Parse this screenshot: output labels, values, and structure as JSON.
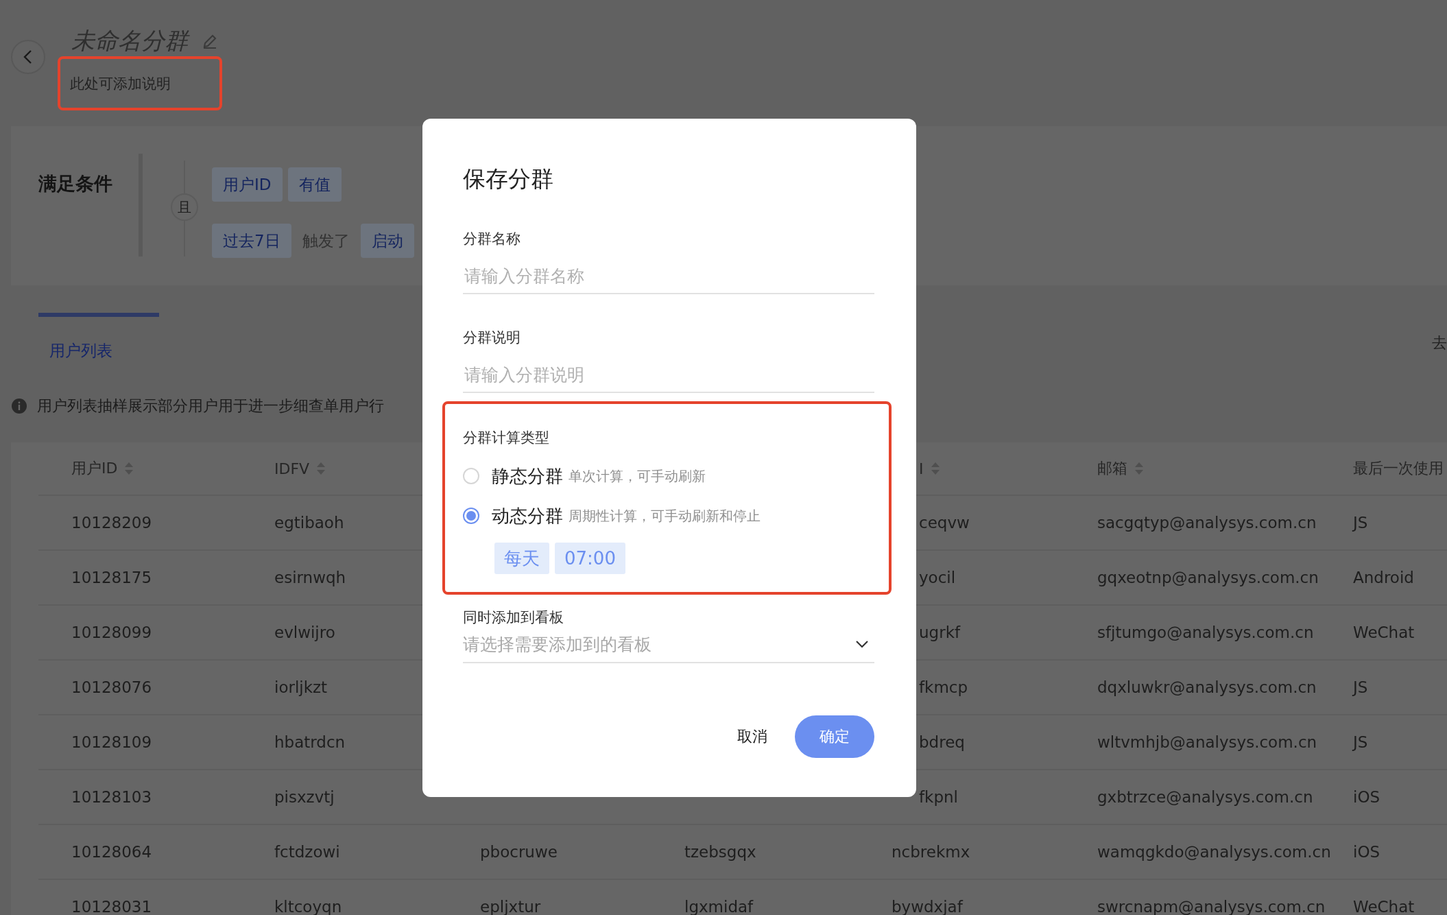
{
  "header": {
    "title": "未命名分群",
    "description": "此处可添加说明",
    "description_highlighted": true
  },
  "conditions": {
    "label": "满足条件",
    "connector": "且",
    "rows": [
      {
        "items": [
          {
            "kind": "tag",
            "text": "用户ID"
          },
          {
            "kind": "tag",
            "text": "有值"
          }
        ]
      },
      {
        "items": [
          {
            "kind": "tag",
            "text": "过去7日"
          },
          {
            "kind": "text",
            "text": "触发了"
          },
          {
            "kind": "tag",
            "text": "启动"
          }
        ]
      }
    ]
  },
  "tabs": [
    {
      "label": "用户列表",
      "selected": true
    }
  ],
  "side_link": "去",
  "notice": "用户列表抽样展示部分用户用于进一步细查单用户行",
  "table": {
    "columns": [
      {
        "label": "用户ID",
        "sortable": true
      },
      {
        "label": "IDFV",
        "sortable": true
      },
      null,
      null,
      {
        "label": "I",
        "sortable": true,
        "clipped": true
      },
      {
        "label": "邮箱",
        "sortable": true
      },
      {
        "label": "最后一次使用"
      }
    ],
    "rows": [
      {
        "cells": [
          {
            "text": "10128209"
          },
          {
            "text": "egtibaoh"
          },
          null,
          null,
          {
            "text": "ceqvw",
            "clipped": true
          },
          {
            "text": "sacgqtyp@analysys.com.cn"
          },
          {
            "text": "JS"
          }
        ]
      },
      {
        "cells": [
          {
            "text": "10128175"
          },
          {
            "text": "esirnwqh"
          },
          null,
          null,
          {
            "text": "yocil",
            "clipped": true
          },
          {
            "text": "gqxeotnp@analysys.com.cn"
          },
          {
            "text": "Android"
          }
        ]
      },
      {
        "cells": [
          {
            "text": "10128099"
          },
          {
            "text": "evlwijro"
          },
          null,
          null,
          {
            "text": "ugrkf",
            "clipped": true
          },
          {
            "text": "sfjtumgo@analysys.com.cn"
          },
          {
            "text": "WeChat"
          }
        ]
      },
      {
        "cells": [
          {
            "text": "10128076"
          },
          {
            "text": "iorljkzt"
          },
          null,
          null,
          {
            "text": "fkmcp",
            "clipped": true
          },
          {
            "text": "dqxluwkr@analysys.com.cn"
          },
          {
            "text": "JS"
          }
        ]
      },
      {
        "cells": [
          {
            "text": "10128109"
          },
          {
            "text": "hbatrdcn"
          },
          null,
          null,
          {
            "text": "bdreq",
            "clipped": true
          },
          {
            "text": "wltvmhjb@analysys.com.cn"
          },
          {
            "text": "JS"
          }
        ]
      },
      {
        "cells": [
          {
            "text": "10128103"
          },
          {
            "text": "pisxzvtj"
          },
          null,
          null,
          {
            "text": "fkpnl",
            "clipped": true
          },
          {
            "text": "gxbtrzce@analysys.com.cn"
          },
          {
            "text": "iOS"
          }
        ]
      },
      {
        "cells": [
          {
            "text": "10128064"
          },
          {
            "text": "fctdzowi"
          },
          {
            "text": "pbocruwe"
          },
          {
            "text": "tzebsgqx"
          },
          {
            "text": "ncbrekmx"
          },
          {
            "text": "wamqgkdo@analysys.com.cn"
          },
          {
            "text": "iOS"
          }
        ]
      },
      {
        "cells": [
          {
            "text": "10128031"
          },
          {
            "text": "kltcoyqn"
          },
          {
            "text": "epljxtur"
          },
          {
            "text": "lgxmidaf"
          },
          {
            "text": "bywdxjaf"
          },
          {
            "text": "swrcnapm@analysys.com.cn"
          },
          {
            "text": "WeChat"
          }
        ]
      }
    ]
  },
  "dialog": {
    "title": "保存分群",
    "name_field": {
      "label": "分群名称",
      "placeholder": "请输入分群名称"
    },
    "description_field": {
      "label": "分群说明",
      "placeholder": "请输入分群说明"
    },
    "calc_type": {
      "label": "分群计算类型",
      "highlighted": true,
      "options": [
        {
          "label": "静态分群",
          "description": "单次计算，可手动刷新",
          "selected": false
        },
        {
          "label": "动态分群",
          "description": "周期性计算，可手动刷新和停止",
          "selected": true
        }
      ],
      "schedule": {
        "frequency": "每天",
        "time": "07:00"
      }
    },
    "dashboard_select": {
      "label": "同时添加到看板",
      "placeholder": "请选择需要添加到的看板"
    },
    "buttons": [
      {
        "kind": "secondary",
        "label": "取消"
      },
      {
        "kind": "primary",
        "label": "确定"
      }
    ]
  }
}
